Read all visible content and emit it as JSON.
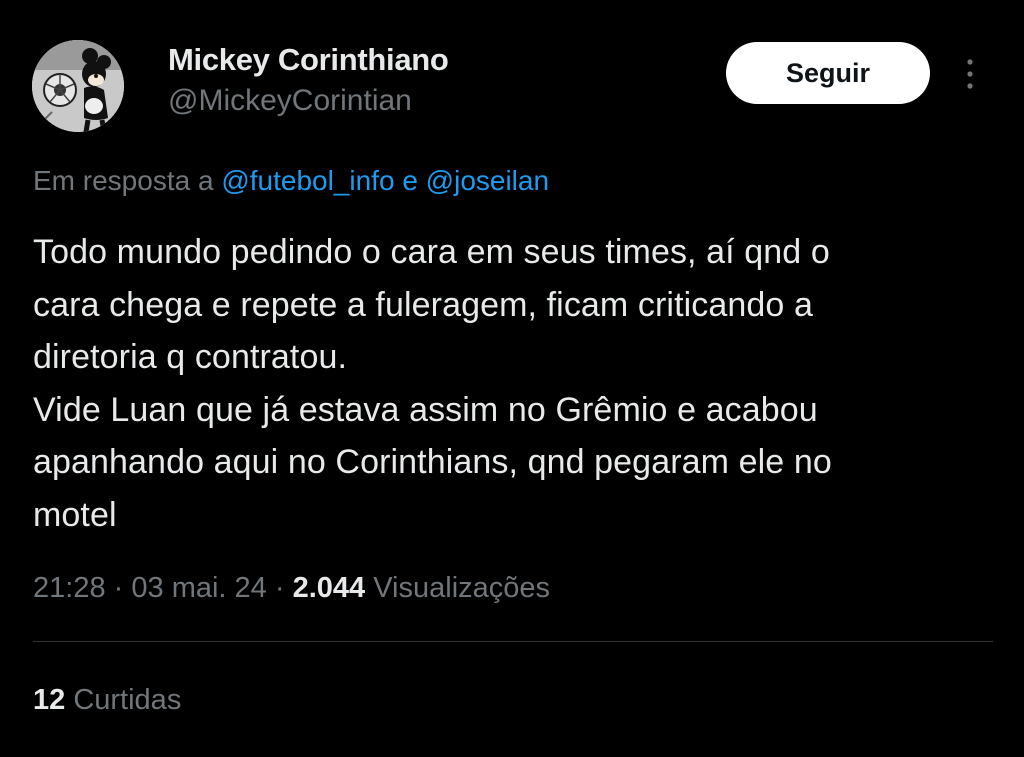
{
  "author": {
    "display_name": "Mickey Corinthiano",
    "handle": "@MickeyCorintian",
    "avatar_icon": "mickey-corinthians-avatar"
  },
  "actions": {
    "follow_label": "Seguir",
    "more_icon": "more-vertical-icon"
  },
  "reply_context": {
    "prefix": "Em resposta a",
    "mention_1": "@futebol_info",
    "joiner": "e",
    "mention_2": "@joseilan"
  },
  "tweet": {
    "lines": [
      "Todo mundo pedindo o cara em seus times, aí qnd o",
      "cara chega e repete a fuleragem, ficam criticando a",
      "diretoria q contratou.",
      "Vide Luan que já estava assim no Grêmio e acabou",
      "apanhando aqui no Corinthians, qnd pegaram ele no",
      "motel"
    ]
  },
  "meta": {
    "time": "21:28",
    "separator": "·",
    "date": "03 mai. 24",
    "views_count": "2.044",
    "views_label": "Visualizações"
  },
  "stats": {
    "likes_count": "12",
    "likes_label": "Curtidas"
  },
  "colors": {
    "background": "#000000",
    "primary_text": "#e7e9ea",
    "secondary_text": "#71767b",
    "link": "#1d9bf0",
    "divider": "#2f3336",
    "button_bg": "#ffffff"
  }
}
